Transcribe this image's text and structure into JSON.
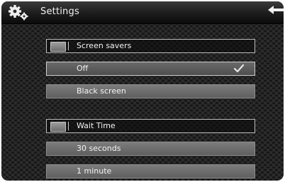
{
  "header": {
    "title": "Settings",
    "settings_icon": "gear-icon",
    "back_icon": "back-arrow-icon"
  },
  "screen_savers": {
    "header_label": "Screen savers",
    "options": [
      {
        "label": "Off",
        "selected": true
      },
      {
        "label": "Black screen",
        "selected": false
      }
    ]
  },
  "wait_time": {
    "header_label": "Wait Time",
    "options": [
      {
        "label": "30 seconds"
      },
      {
        "label": "1 minute"
      }
    ]
  },
  "colors": {
    "background": "#121212",
    "option_fill": "#6e6e6e",
    "text": "#f3f3f3"
  }
}
